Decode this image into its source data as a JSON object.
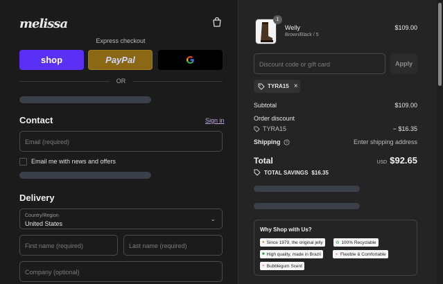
{
  "brand": {
    "logo_text": "melissa"
  },
  "express_checkout": {
    "label": "Express checkout",
    "buttons": {
      "shop": "shop",
      "paypal": "PayPal"
    },
    "or": "OR"
  },
  "contact": {
    "title": "Contact",
    "sign_in": "Sign in",
    "email_placeholder": "Email (required)",
    "newsletter_label": "Email me with news and offers"
  },
  "delivery": {
    "title": "Delivery",
    "country_label": "Country/Region",
    "country_value": "United States",
    "first_name_placeholder": "First name (required)",
    "last_name_placeholder": "Last name (required)",
    "company_placeholder": "Company (optional)"
  },
  "cart": {
    "item": {
      "name": "Welly",
      "variant": "Brown/Black / 5",
      "price": "$109.00",
      "quantity": "1"
    },
    "discount_placeholder": "Discount code or gift card",
    "apply_label": "Apply",
    "applied_code": "TYRA15"
  },
  "summary": {
    "subtotal_label": "Subtotal",
    "subtotal_value": "$109.00",
    "order_discount_label": "Order discount",
    "discount_code": "TYRA15",
    "discount_value": "− $16.35",
    "shipping_label": "Shipping",
    "shipping_value": "Enter shipping address",
    "total_label": "Total",
    "total_currency": "USD",
    "total_value": "$92.65",
    "savings_label": "TOTAL SAVINGS",
    "savings_value": "$16.35"
  },
  "why_shop": {
    "title": "Why Shop with Us?",
    "badges": [
      {
        "label": "Since 1979, the original jelly",
        "icon": "jelly-icon"
      },
      {
        "label": "100% Recyclable",
        "icon": "recycle-icon"
      },
      {
        "label": "High quality, made in Brazil",
        "icon": "brazil-flag-icon"
      },
      {
        "label": "Flexible & Comfortable",
        "icon": "sparkle-icon"
      },
      {
        "label": "Bubblegum Scent",
        "icon": "bubblegum-icon"
      }
    ]
  },
  "colors": {
    "background": "#1b1b1b",
    "summary_background": "#242424",
    "shop_pay": "#5a31f4",
    "paypal": "#8b6914",
    "link": "#c4a8e8"
  }
}
